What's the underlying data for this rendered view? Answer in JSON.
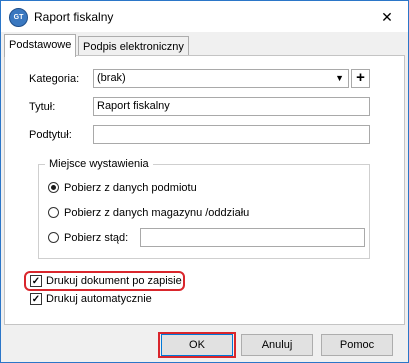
{
  "window": {
    "title": "Raport fiskalny",
    "app_icon_text": "GT"
  },
  "tabs": [
    {
      "label": "Podstawowe",
      "active": true
    },
    {
      "label": "Podpis elektroniczny",
      "active": false
    }
  ],
  "form": {
    "kategoria_label": "Kategoria:",
    "kategoria_value": "(brak)",
    "tytul_label": "Tytuł:",
    "tytul_value": "Raport fiskalny",
    "podtytul_label": "Podtytuł:",
    "podtytul_value": ""
  },
  "group": {
    "legend": "Miejsce wystawienia",
    "options": [
      {
        "label": "Pobierz z danych podmiotu",
        "selected": true
      },
      {
        "label": "Pobierz z danych magazynu /oddziału",
        "selected": false
      },
      {
        "label": "Pobierz stąd:",
        "selected": false
      }
    ],
    "custom_value": ""
  },
  "checkboxes": [
    {
      "label": "Drukuj dokument po zapisie",
      "checked": true
    },
    {
      "label": "Drukuj automatycznie",
      "checked": true
    }
  ],
  "buttons": {
    "ok": "OK",
    "cancel": "Anuluj",
    "help": "Pomoc"
  },
  "glyphs": {
    "close": "✕",
    "plus": "+",
    "dropdown": "▼",
    "check": "✓"
  },
  "colors": {
    "highlight": "#d9262c",
    "accent": "#0078d7"
  }
}
